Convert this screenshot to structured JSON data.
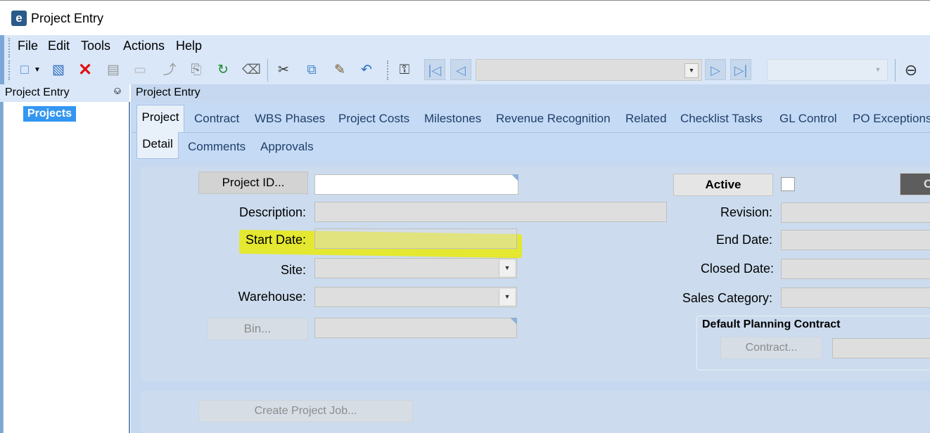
{
  "window": {
    "title": "Project Entry",
    "logo_letter": "e"
  },
  "menu": {
    "items": [
      "File",
      "Edit",
      "Tools",
      "Actions",
      "Help"
    ]
  },
  "toolbar": {
    "icons": [
      "new-icon",
      "dropdown-arrow-icon",
      "save-icon",
      "delete-icon",
      "book-icon",
      "blank-icon",
      "attach-icon",
      "copy-attach-icon",
      "refresh-icon",
      "eraser-icon",
      "cut-icon",
      "copy-icon",
      "paste-icon",
      "undo-icon",
      "search-binoculars-icon",
      "first-record-icon",
      "previous-record-icon",
      "next-record-icon",
      "last-record-icon",
      "back-circle-icon"
    ],
    "nav_combo_value": "",
    "second_combo_value": ""
  },
  "left_panel": {
    "title": "Project Entry",
    "items": [
      "Projects"
    ]
  },
  "right_panel": {
    "title": "Project Entry",
    "tabs": [
      "Project",
      "Contract",
      "WBS Phases",
      "Project Costs",
      "Milestones",
      "Revenue Recognition",
      "Related",
      "Checklist Tasks",
      "GL Control",
      "PO Exceptions"
    ],
    "subtabs": [
      "Detail",
      "Comments",
      "Approvals"
    ]
  },
  "form": {
    "project_id_button": "Project ID...",
    "description_label": "Description:",
    "start_date_label": "Start Date:",
    "site_label": "Site:",
    "warehouse_label": "Warehouse:",
    "bin_button": "Bin...",
    "active_button": "Active",
    "active_checked": false,
    "revision_label": "Revision:",
    "end_date_label": "End Date:",
    "closed_date_label": "Closed Date:",
    "sales_category_label": "Sales Category:",
    "planning_group_title": "Default Planning Contract",
    "contract_button": "Contract...",
    "create_job_button": "Create Project Job...",
    "cut_button_label": "C",
    "project_id": "",
    "description": "",
    "start_date": "",
    "site": "",
    "warehouse": "",
    "bin": "",
    "revision": "",
    "end_date": "",
    "closed_date": "",
    "sales_category": "",
    "contract": ""
  },
  "colors": {
    "highlight": "#e8ea0e",
    "selected_item": "#3397f2",
    "panel_bg": "#c5d8ef"
  }
}
